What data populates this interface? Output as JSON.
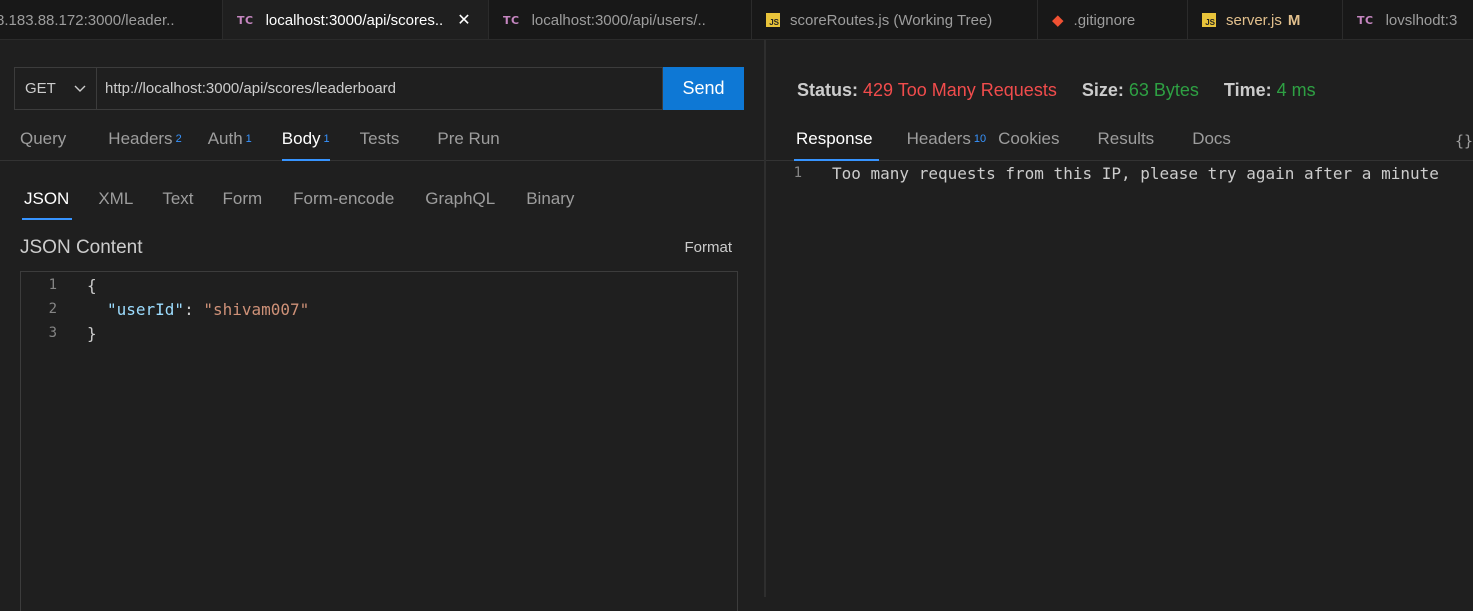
{
  "tabs": [
    {
      "icon": "none",
      "label": "8.183.88.172:3000/leader..",
      "active": false
    },
    {
      "icon": "tc",
      "label": "localhost:3000/api/scores..",
      "active": true,
      "close": "✕"
    },
    {
      "icon": "tc",
      "label": "localhost:3000/api/users/..",
      "active": false
    },
    {
      "icon": "js",
      "label": "scoreRoutes.js (Working Tree)",
      "active": false
    },
    {
      "icon": "git",
      "label": ".gitignore",
      "active": false
    },
    {
      "icon": "js",
      "label": "server.js",
      "active": false,
      "modified": "M"
    },
    {
      "icon": "tc",
      "label": "lovslhodt:3",
      "active": false
    }
  ],
  "tab_icon_text": {
    "tc": "TC",
    "js": "JS"
  },
  "request": {
    "method": "GET",
    "url": "http://localhost:3000/api/scores/leaderboard",
    "send_label": "Send",
    "tabs": [
      {
        "label": "Query",
        "badge": ""
      },
      {
        "label": "Headers",
        "badge": "2"
      },
      {
        "label": "Auth",
        "badge": "1"
      },
      {
        "label": "Body",
        "badge": "1",
        "active": true
      },
      {
        "label": "Tests",
        "badge": ""
      },
      {
        "label": "Pre Run",
        "badge": ""
      }
    ],
    "body_tabs": [
      "JSON",
      "XML",
      "Text",
      "Form",
      "Form-encode",
      "GraphQL",
      "Binary"
    ],
    "body_active": "JSON",
    "content_title": "JSON Content",
    "format_label": "Format",
    "editor_lines": [
      {
        "n": "1",
        "open": "{"
      },
      {
        "n": "2",
        "key": "\"userId\"",
        "sep": ": ",
        "value": "\"shivam007\""
      },
      {
        "n": "3",
        "close": "}"
      }
    ]
  },
  "response": {
    "status_label": "Status:",
    "status_value": "429 Too Many Requests",
    "size_label": "Size:",
    "size_value": "63 Bytes",
    "time_label": "Time:",
    "time_value": "4 ms",
    "tabs": [
      {
        "label": "Response",
        "badge": "",
        "active": true
      },
      {
        "label": "Headers",
        "badge": "10"
      },
      {
        "label": "Cookies",
        "badge": ""
      },
      {
        "label": "Results",
        "badge": ""
      },
      {
        "label": "Docs",
        "badge": ""
      }
    ],
    "braces_label": "{}",
    "line_number": "1",
    "body_text": "Too many requests from this IP, please try again after a minute"
  },
  "colors": {
    "accent": "#3794ff",
    "send_button": "#0e78d5",
    "status_error": "#f14c4c",
    "ok_green": "#2ea043"
  }
}
